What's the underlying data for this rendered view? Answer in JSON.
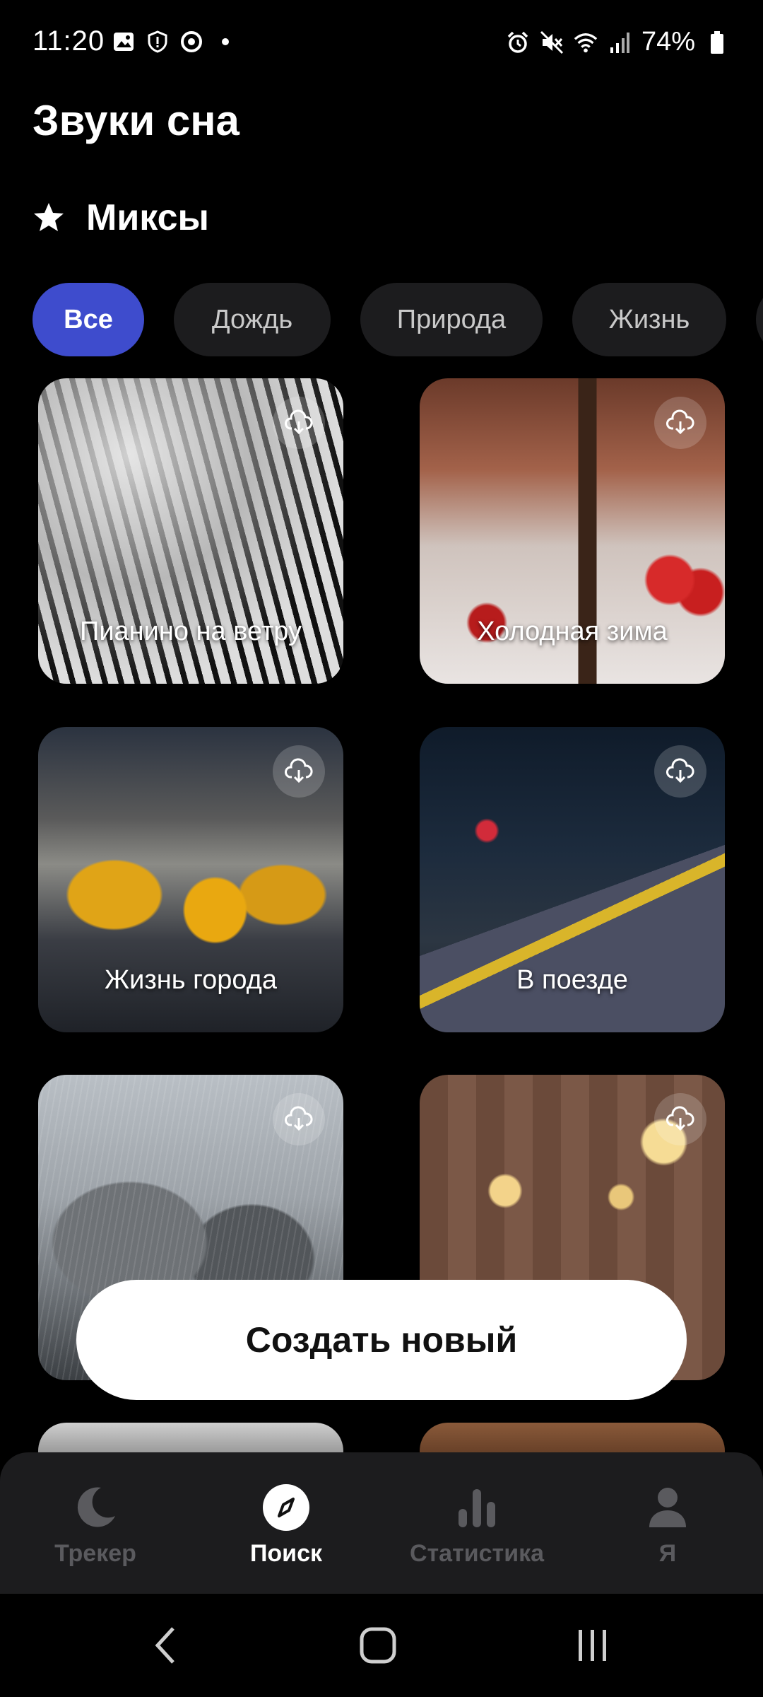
{
  "status_bar": {
    "time": "11:20",
    "battery": "74%",
    "left_icons": [
      "gallery-icon",
      "shield-icon",
      "chrome-icon",
      "dot-icon"
    ],
    "right_icons": [
      "alarm-icon",
      "mute-icon",
      "wifi-icon",
      "signal-icon",
      "battery-icon"
    ]
  },
  "header": {
    "title": "Звуки сна",
    "section_title": "Миксы"
  },
  "filters": {
    "selected": "Все",
    "chips": [
      "Все",
      "Дождь",
      "Природа",
      "Жизнь"
    ]
  },
  "cards": [
    {
      "label": "Пианино на ветру"
    },
    {
      "label": "Холодная зима"
    },
    {
      "label": "Жизнь города"
    },
    {
      "label": "В поезде"
    },
    {
      "label": ""
    },
    {
      "label": ""
    }
  ],
  "create_button": {
    "label": "Создать новый"
  },
  "bottom_nav": {
    "active": "Поиск",
    "items": [
      {
        "label": "Трекер",
        "icon": "moon-icon"
      },
      {
        "label": "Поиск",
        "icon": "compass-icon"
      },
      {
        "label": "Статистика",
        "icon": "bar-chart-icon"
      },
      {
        "label": "Я",
        "icon": "person-icon"
      }
    ]
  },
  "colors": {
    "background": "#000000",
    "accent": "#3e4ccd",
    "chip_bg": "#1c1c1e",
    "nav_bg": "#1c1c1e",
    "inactive_text": "#5a5a5e"
  }
}
